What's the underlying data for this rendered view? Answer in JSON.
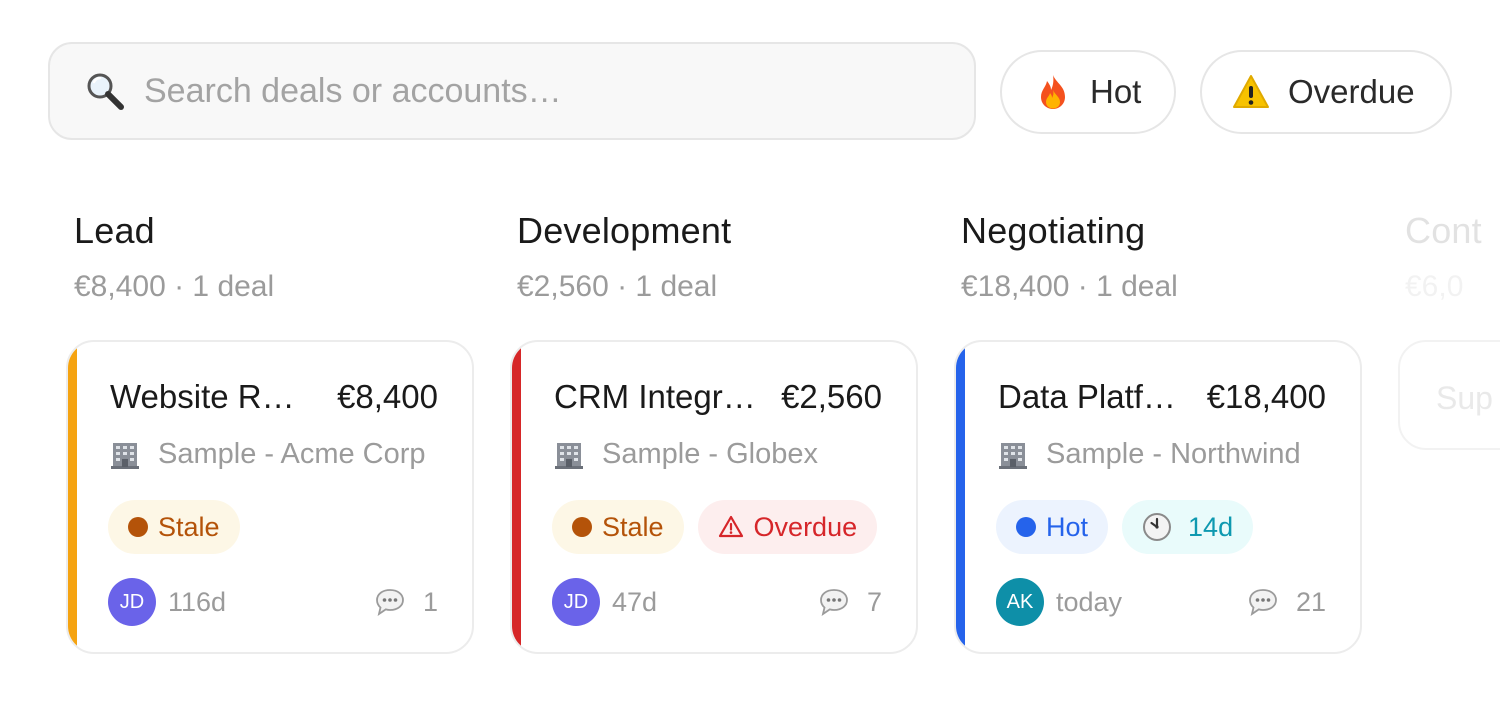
{
  "search": {
    "placeholder": "Search deals or accounts…"
  },
  "filters": [
    {
      "label": "Hot",
      "icon": "fire-icon"
    },
    {
      "label": "Overdue",
      "icon": "warning-icon"
    }
  ],
  "columns": [
    {
      "title": "Lead",
      "summary": "€8,400 · 1 deal",
      "card": {
        "title": "Website R…",
        "value": "€8,400",
        "account": "Sample - Acme Corp",
        "accent_color": "#f5a311",
        "tags": [
          {
            "type": "stale",
            "label": "Stale"
          }
        ],
        "owner_initials": "JD",
        "owner_color": "#6a63e9",
        "age": "116d",
        "comments": "1"
      }
    },
    {
      "title": "Development",
      "summary": "€2,560 · 1 deal",
      "card": {
        "title": "CRM Integr…",
        "value": "€2,560",
        "account": "Sample - Globex",
        "accent_color": "#d62728",
        "tags": [
          {
            "type": "stale",
            "label": "Stale"
          },
          {
            "type": "overdue",
            "label": "Overdue"
          }
        ],
        "owner_initials": "JD",
        "owner_color": "#6a63e9",
        "age": "47d",
        "comments": "7"
      }
    },
    {
      "title": "Negotiating",
      "summary": "€18,400 · 1 deal",
      "card": {
        "title": "Data Platf…",
        "value": "€18,400",
        "account": "Sample - Northwind",
        "accent_color": "#2563eb",
        "tags": [
          {
            "type": "hot",
            "label": "Hot"
          },
          {
            "type": "time",
            "label": "14d"
          }
        ],
        "owner_initials": "AK",
        "owner_color": "#0e8fa8",
        "age": "today",
        "comments": "21"
      }
    },
    {
      "title": "Cont",
      "summary": "€6,0",
      "card": {
        "title": "Sup"
      }
    }
  ],
  "colors": {
    "border": "#e6e6e6",
    "muted_text": "#9b9b9b"
  }
}
